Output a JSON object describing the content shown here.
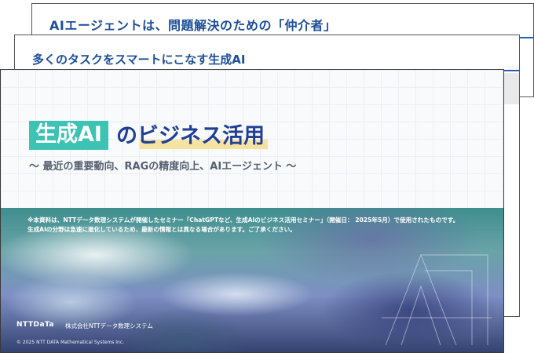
{
  "back_slide": {
    "title": "AIエージェントは、問題解決のための「仲介者」"
  },
  "middle_slide": {
    "title": "多くのタスクをスマートにこなす生成AI"
  },
  "front_slide": {
    "title_badge": "生成AI",
    "title_rest": "のビジネス活用",
    "subtitle": "〜 最近の重要動向、RAGの精度向上、AIエージェント 〜",
    "notice_line1": "※本資料は、NTTデータ数理システムが開催したセミナー「ChatGPTなど、生成AIのビジネス活用セミナー」（開催日： 2025年5月）で使用されたものです。",
    "notice_line2": "生成AIの分野は急速に進化しているため、最新の情報とは異なる場合があります。ご了承ください。",
    "logo": "NTTDaTa",
    "company": "株式会社NTTデータ数理システム",
    "copyright": "© 2025 NTT DATA Mathematical Systems Inc."
  },
  "colors": {
    "accent_teal": "#3cc3b4",
    "title_navy": "#1f3f93",
    "rule_blue": "#1e5fb4",
    "highlight_yellow": "#f6e3a3"
  }
}
